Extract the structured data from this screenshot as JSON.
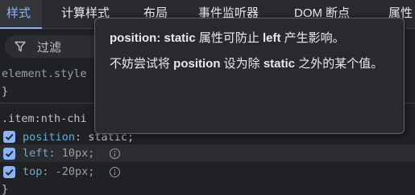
{
  "tabs": [
    {
      "label": "样式",
      "active": true
    },
    {
      "label": "计算样式"
    },
    {
      "label": "布局"
    },
    {
      "label": "事件监听器"
    },
    {
      "label": "DOM 断点"
    },
    {
      "label": "属性"
    }
  ],
  "filter": {
    "label": "过滤",
    "icon": "filter-icon"
  },
  "rules": {
    "element_style": "element.style {",
    "element_style_close": "}",
    "selector": ".item:nth-chi",
    "declarations": [
      {
        "prop": "position",
        "value": "static;",
        "checked": true
      },
      {
        "prop": "left",
        "value": "10px;",
        "checked": true,
        "warning": true
      },
      {
        "prop": "top",
        "value": "-20px;",
        "checked": true
      }
    ],
    "close_brace": "}"
  },
  "tooltip": {
    "line1_prefix": "position: static",
    "line1_mid": " 属性可防止 ",
    "line1_bold2": "left",
    "line1_suffix": " 产生影响。",
    "line2_a": "不妨尝试将 ",
    "line2_b": "position",
    "line2_c": " 设为除 ",
    "line2_d": "static",
    "line2_e": " 之外的某个值。"
  },
  "colors": {
    "accent": "#8ab4f8",
    "background": "#202124",
    "property": "#5db0d7"
  }
}
